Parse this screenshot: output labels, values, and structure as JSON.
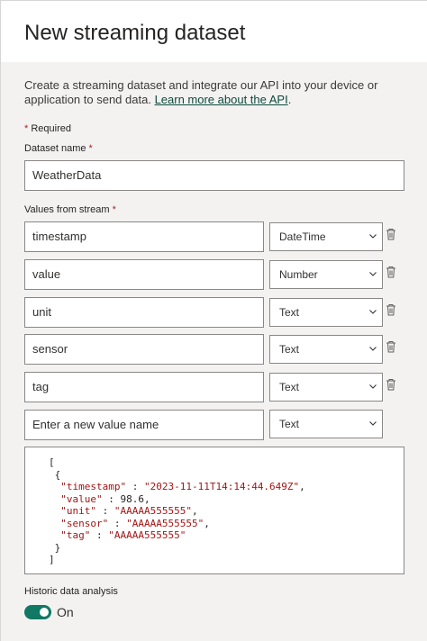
{
  "header": {
    "title": "New streaming dataset"
  },
  "intro": {
    "text": "Create a streaming dataset and integrate our API into your device or application to send data. ",
    "link": "Learn more about the API",
    "suffix": "."
  },
  "required_note": {
    "star": "*",
    "text": " Required"
  },
  "dataset_name": {
    "label": "Dataset name",
    "value": "WeatherData"
  },
  "values_from_stream": {
    "label": "Values from stream",
    "rows": [
      {
        "name": "timestamp",
        "type": "DateTime"
      },
      {
        "name": "value",
        "type": "Number"
      },
      {
        "name": "unit",
        "type": "Text"
      },
      {
        "name": "sensor",
        "type": "Text"
      },
      {
        "name": "tag",
        "type": "Text"
      }
    ],
    "new_row": {
      "placeholder": "Enter a new value name",
      "type": "Text"
    }
  },
  "sample_json": {
    "open_bracket": "[",
    "open_brace": "{",
    "lines": [
      {
        "key": "\"timestamp\"",
        "sep": " : ",
        "val": "\"2023-11-11T14:14:44.649Z\"",
        "comma": ","
      },
      {
        "key": "\"value\"",
        "sep": " : ",
        "val": "98.6",
        "comma": ","
      },
      {
        "key": "\"unit\"",
        "sep": " : ",
        "val": "\"AAAAA555555\"",
        "comma": ","
      },
      {
        "key": "\"sensor\"",
        "sep": " : ",
        "val": "\"AAAAA555555\"",
        "comma": ","
      },
      {
        "key": "\"tag\"",
        "sep": " : ",
        "val": "\"AAAAA555555\"",
        "comma": ""
      }
    ],
    "close_brace": "}",
    "close_bracket": "]"
  },
  "historic": {
    "label": "Historic data analysis",
    "state": "On",
    "enabled": true
  },
  "colors": {
    "accent": "#117865",
    "link": "#0e4a3d",
    "required": "#a4262c"
  }
}
